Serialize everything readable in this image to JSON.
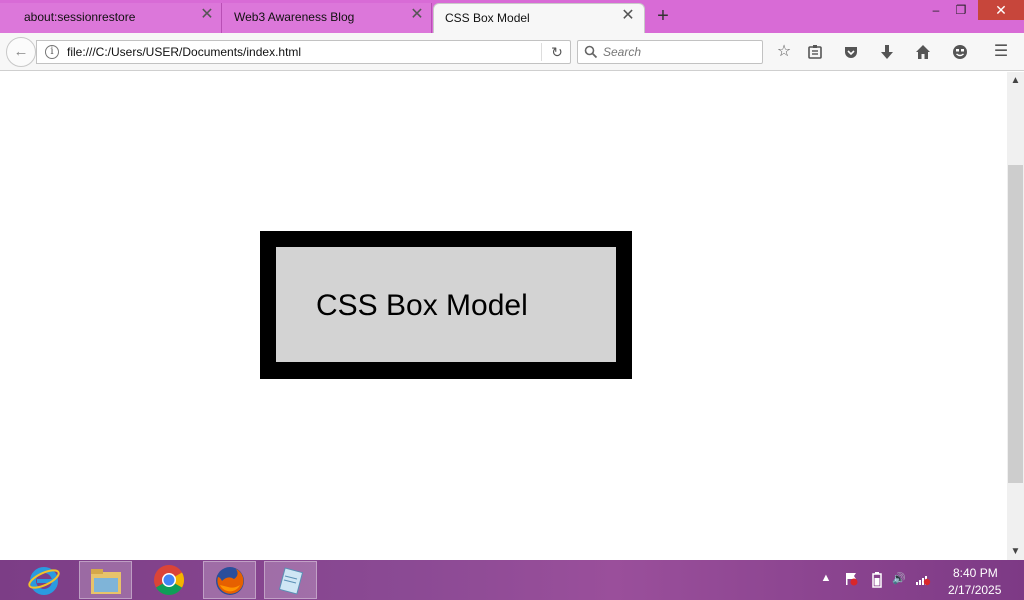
{
  "browser": {
    "tabs": [
      {
        "label": "about:sessionrestore",
        "active": false
      },
      {
        "label": "Web3 Awareness Blog",
        "active": false
      },
      {
        "label": "CSS Box Model",
        "active": true
      }
    ],
    "url": "file:///C:/Users/USER/Documents/index.html",
    "search_placeholder": "Search",
    "accent_color": "#d86bd6"
  },
  "page": {
    "box_text": "CSS Box Model",
    "box_border_color": "#000000",
    "box_background_color": "#d3d3d3"
  },
  "taskbar": {
    "apps": [
      "internet-explorer-icon",
      "file-explorer-icon",
      "chrome-icon",
      "firefox-icon",
      "notepad-icon"
    ],
    "time": "8:40 PM",
    "date": "2/17/2025"
  }
}
